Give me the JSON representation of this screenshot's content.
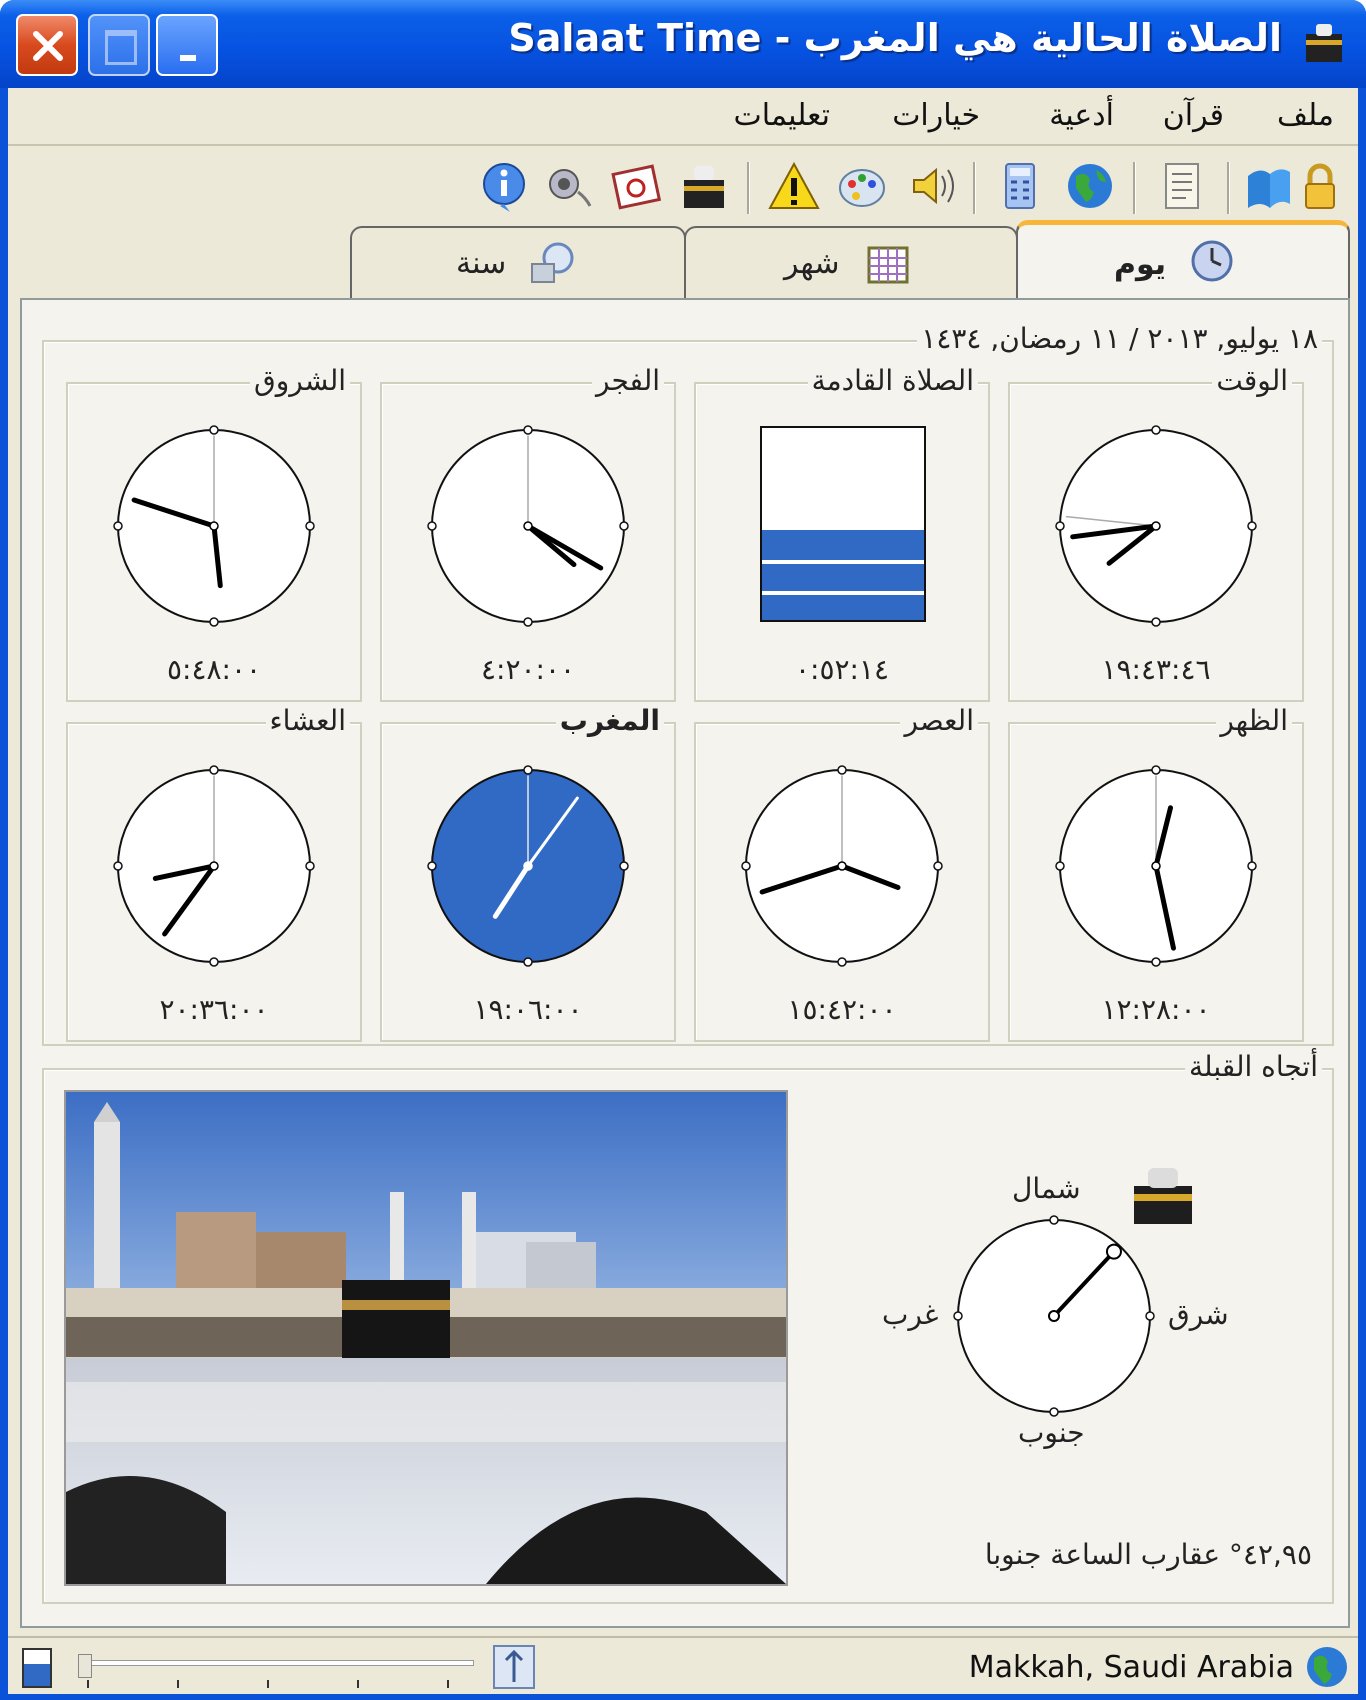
{
  "window": {
    "title": "Salaat Time - الصلاة الحالية هي المغرب",
    "accent": "#0651e0"
  },
  "menu": {
    "items": [
      "ملف",
      "قرآن",
      "أدعية",
      "خيارات",
      "تعليمات"
    ]
  },
  "toolbar": {
    "icons": [
      "lock-icon",
      "book-icon",
      "notepad-icon",
      "globe-icon",
      "calculator-icon",
      "speaker-icon",
      "palette-icon",
      "warning-icon",
      "kaaba-icon",
      "calendar-alarm-icon",
      "sound-icon",
      "info-icon"
    ]
  },
  "tabs": {
    "day": "يوم",
    "month": "شهر",
    "year": "سنة"
  },
  "date_group": {
    "title": "١٨ يوليو, ٢٠١٣ / ١١ رمضان, ١٤٣٤"
  },
  "clocks": {
    "time": {
      "title": "الوقت",
      "value": "١٩:٤٣:٤٦"
    },
    "next_prayer": {
      "title": "الصلاة القادمة",
      "value": "٠:٥٢:١٤",
      "progress_remaining_fraction": 0.47
    },
    "fajr": {
      "title": "الفجر",
      "value": "٤:٢٠:٠٠"
    },
    "sunrise": {
      "title": "الشروق",
      "value": "٥:٤٨:٠٠"
    },
    "dhuhr": {
      "title": "الظهر",
      "value": "١٢:٢٨:٠٠"
    },
    "asr": {
      "title": "العصر",
      "value": "١٥:٤٢:٠٠"
    },
    "maghrib": {
      "title": "المغرب",
      "value": "١٩:٠٦:٠٠",
      "current": true,
      "highlight_color": "#316ac5"
    },
    "isha": {
      "title": "العشاء",
      "value": "٢٠:٣٦:٠٠"
    }
  },
  "qibla": {
    "title": "أتجاه القبلة",
    "north": "شمال",
    "south": "جنوب",
    "east": "شرق",
    "west": "غرب",
    "bearing_degrees": 42.95,
    "bearing_text": "٤٢,٩٥° عقارب الساعة جنوبا"
  },
  "status": {
    "location": "Makkah, Saudi Arabia"
  }
}
